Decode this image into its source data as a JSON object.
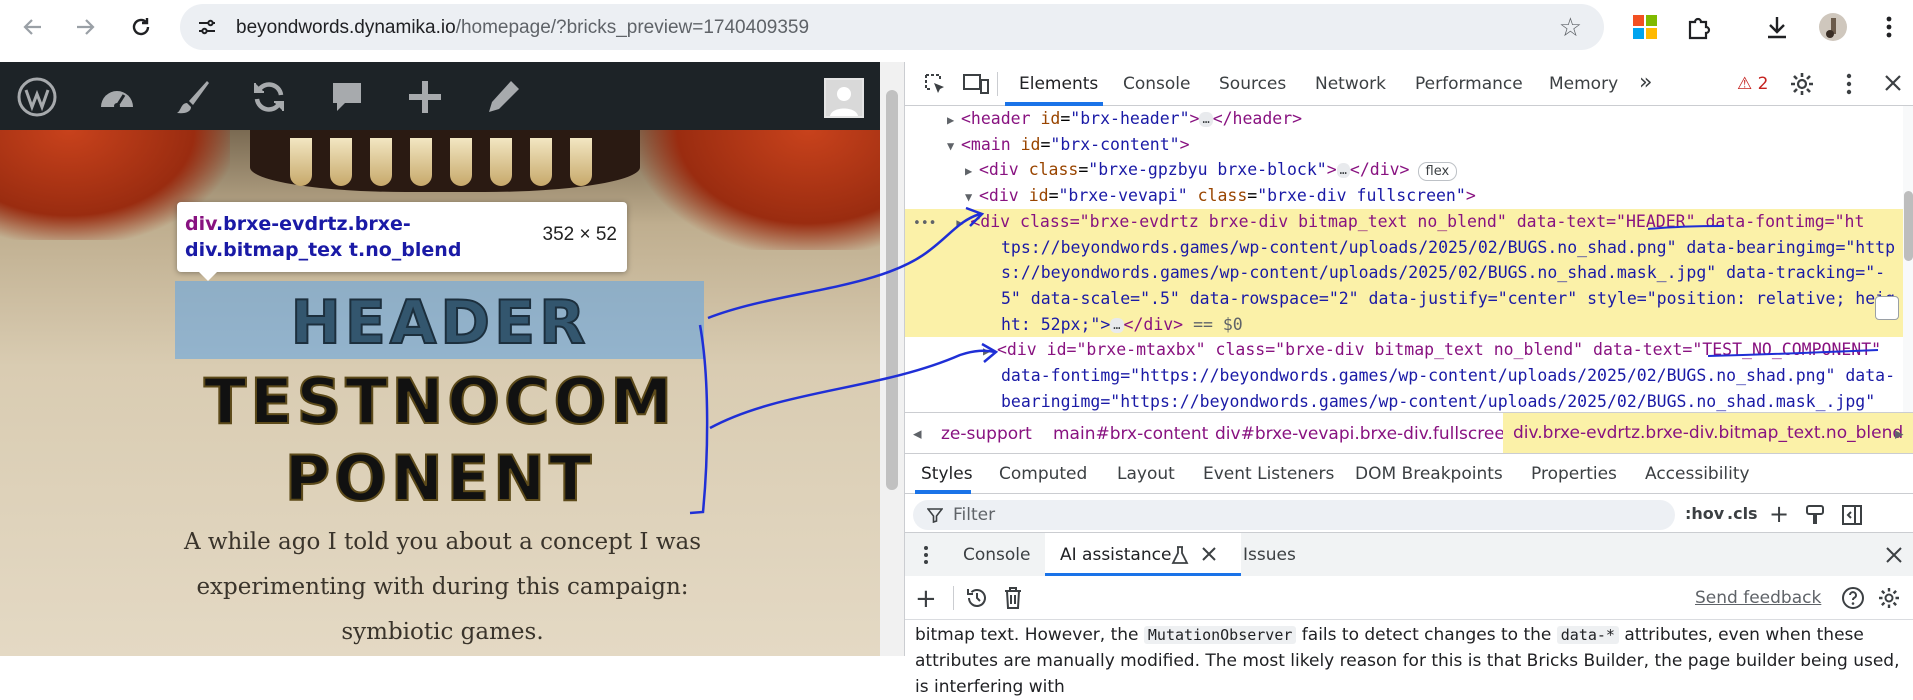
{
  "browser": {
    "url_host": "beyondwords.dynamika.io",
    "url_rest": "/homepage/?bricks_preview=1740409359"
  },
  "page": {
    "bitmap_header": "HEADER",
    "bitmap_line1": "TESTNOCOM",
    "bitmap_line2": "PONENT",
    "paragraph": "A while ago I told you about a concept I was experimenting with during this campaign: symbiotic games.",
    "tooltip_tag": "div",
    "tooltip_selector": ".brxe-evdrtz.brxe-div.bitmap_tex t.no_blend",
    "tooltip_size": "352 × 52"
  },
  "devtools": {
    "tabs": [
      "Elements",
      "Console",
      "Sources",
      "Network",
      "Performance",
      "Memory"
    ],
    "more": "»",
    "warnings": "2",
    "dom": {
      "l1_tag_open": "<header",
      "l1_attr": "id",
      "l1_val": "\"brx-header\"",
      "l1_close": "</header>",
      "l2_tag_open": "<main",
      "l2_attr": "id",
      "l2_val": "\"brx-content\"",
      "l3_tag_open": "<div",
      "l3_attr": "class",
      "l3_val": "\"brxe-gpzbyu brxe-block\"",
      "l3_close": "</div>",
      "l3_badge": "flex",
      "l4_tag_open": "<div",
      "l4_attr1": "id",
      "l4_val1": "\"brxe-vevapi\"",
      "l4_attr2": "class",
      "l4_val2": "\"brxe-div fullscreen\"",
      "sel_l1": "<div class=\"brxe-evdrtz brxe-div bitmap_text no_blend\" data-text=\"HEADER\" data-fontimg=\"ht",
      "sel_l2": "tps://beyondwords.games/wp-content/uploads/2025/02/BUGS.no_shad.png\" data-bearingimg=\"http",
      "sel_l3": "s://beyondwords.games/wp-content/uploads/2025/02/BUGS.no_shad.mask_.jpg\" data-tracking=\"-",
      "sel_l4": "5\" data-scale=\".5\" data-rowspace=\"2\" data-justify=\"center\" style=\"position: relative; heig",
      "sel_l5a": "ht: 52px;\">",
      "sel_l5b": "</div>",
      "sel_l5c": "== $0",
      "n_l1": "<div id=\"brxe-mtaxbx\" class=\"brxe-div bitmap_text no_blend\" data-text=\"TEST_NO_COMPONENT\"",
      "n_l2": "data-fontimg=\"https://beyondwords.games/wp-content/uploads/2025/02/BUGS.no_shad.png\" data-",
      "n_l3": "bearingimg=\"https://beyondwords.games/wp-content/uploads/2025/02/BUGS.no_shad.mask_.jpg\"",
      "ellipsis": "…"
    },
    "breadcrumbs": [
      "ze-support",
      "main#brx-content",
      "div#brxe-vevapi.brxe-div.fullscreen",
      "div.brxe-evdrtz.brxe-div.bitmap_text.no_blend"
    ],
    "style_tabs": [
      "Styles",
      "Computed",
      "Layout",
      "Event Listeners",
      "DOM Breakpoints",
      "Properties",
      "Accessibility"
    ],
    "filter_placeholder": "Filter",
    "hov": ":hov",
    "cls": ".cls",
    "drawer_tabs": [
      "Console",
      "AI assistance",
      "Issues"
    ],
    "send_feedback": "Send feedback",
    "ai_text_1": "bitmap text. However, the ",
    "ai_code_1": "MutationObserver",
    "ai_text_2": " fails to detect changes to the ",
    "ai_code_2": "data-*",
    "ai_text_3": " attributes, even when these attributes are manually modified. The most likely reason for this is that Bricks Builder, the page builder being used, is interfering with"
  }
}
